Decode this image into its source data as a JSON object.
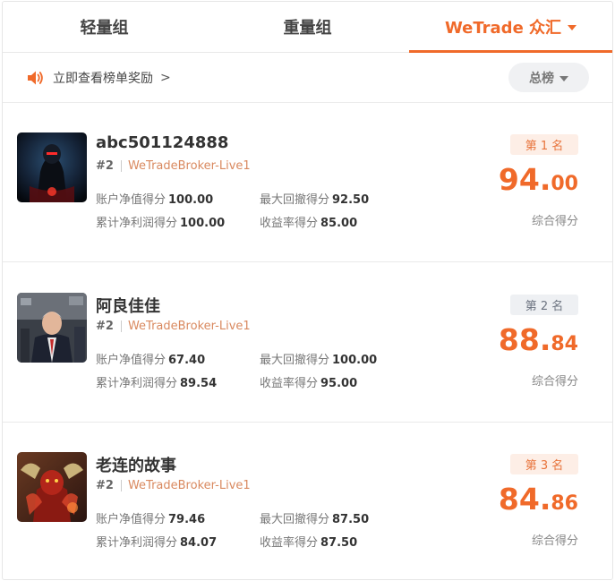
{
  "tabs": [
    {
      "label": "轻量组",
      "active": false
    },
    {
      "label": "重量组",
      "active": false
    },
    {
      "label": "WeTrade 众汇",
      "active": true
    }
  ],
  "notice": {
    "text": "立即查看榜单奖励",
    "arrow": ">"
  },
  "board_select": {
    "label": "总榜"
  },
  "colors": {
    "accent": "#f06a2a",
    "broker_text": "#d9895f"
  },
  "stat_labels": {
    "equity": "账户净值得分",
    "drawdown": "最大回撤得分",
    "net_profit": "累计净利润得分",
    "return_rate": "收益率得分"
  },
  "score_label": "综合得分",
  "entries": [
    {
      "name": "abc501124888",
      "rank_code": "#2",
      "broker": "WeTradeBroker-Live1",
      "equity": "100.00",
      "drawdown": "92.50",
      "net_profit": "100.00",
      "return_rate": "85.00",
      "badge": "第 1 名",
      "score_int": "94",
      "score_dot": ".",
      "score_dec": "00"
    },
    {
      "name": "阿良佳佳",
      "rank_code": "#2",
      "broker": "WeTradeBroker-Live1",
      "equity": "67.40",
      "drawdown": "100.00",
      "net_profit": "89.54",
      "return_rate": "95.00",
      "badge": "第 2 名",
      "score_int": "88",
      "score_dot": ".",
      "score_dec": "84"
    },
    {
      "name": "老连的故事",
      "rank_code": "#2",
      "broker": "WeTradeBroker-Live1",
      "equity": "79.46",
      "drawdown": "87.50",
      "net_profit": "84.07",
      "return_rate": "87.50",
      "badge": "第 3 名",
      "score_int": "84",
      "score_dot": ".",
      "score_dec": "86"
    }
  ]
}
